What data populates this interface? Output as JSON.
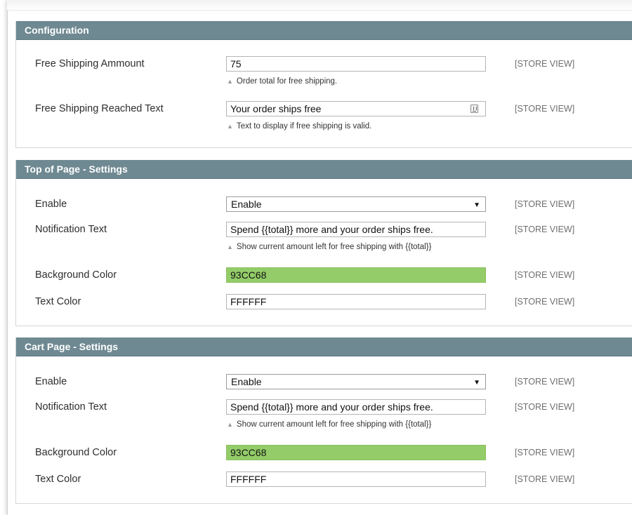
{
  "store_view_label": "[STORE VIEW]",
  "configuration": {
    "title": "Configuration",
    "free_shipping_amount": {
      "label": "Free Shipping Ammount",
      "value": "75",
      "note": "Order total for free shipping."
    },
    "free_shipping_reached_text": {
      "label": "Free Shipping Reached Text",
      "value": "Your order ships free",
      "note": "Text to display if free shipping is valid."
    }
  },
  "top_of_page": {
    "title": "Top of Page - Settings",
    "enable": {
      "label": "Enable",
      "value": "Enable"
    },
    "notification_text": {
      "label": "Notification Text",
      "value": "Spend {{total}} more and your order ships free.",
      "note": "Show current amount left for free shipping with {{total}}"
    },
    "background_color": {
      "label": "Background Color",
      "value": "93CC68"
    },
    "text_color": {
      "label": "Text Color",
      "value": "FFFFFF"
    }
  },
  "cart_page": {
    "title": "Cart Page - Settings",
    "enable": {
      "label": "Enable",
      "value": "Enable"
    },
    "notification_text": {
      "label": "Notification Text",
      "value": "Spend {{total}} more and your order ships free.",
      "note": "Show current amount left for free shipping with {{total}}"
    },
    "background_color": {
      "label": "Background Color",
      "value": "93CC68"
    },
    "text_color": {
      "label": "Text Color",
      "value": "FFFFFF"
    }
  },
  "colors": {
    "header_bg": "#6f8992",
    "green_swatch": "#93cc68"
  },
  "icons": {
    "note": "triangle-up-icon",
    "select": "dropdown-arrow-icon",
    "textarea": "text-editor-icon"
  }
}
